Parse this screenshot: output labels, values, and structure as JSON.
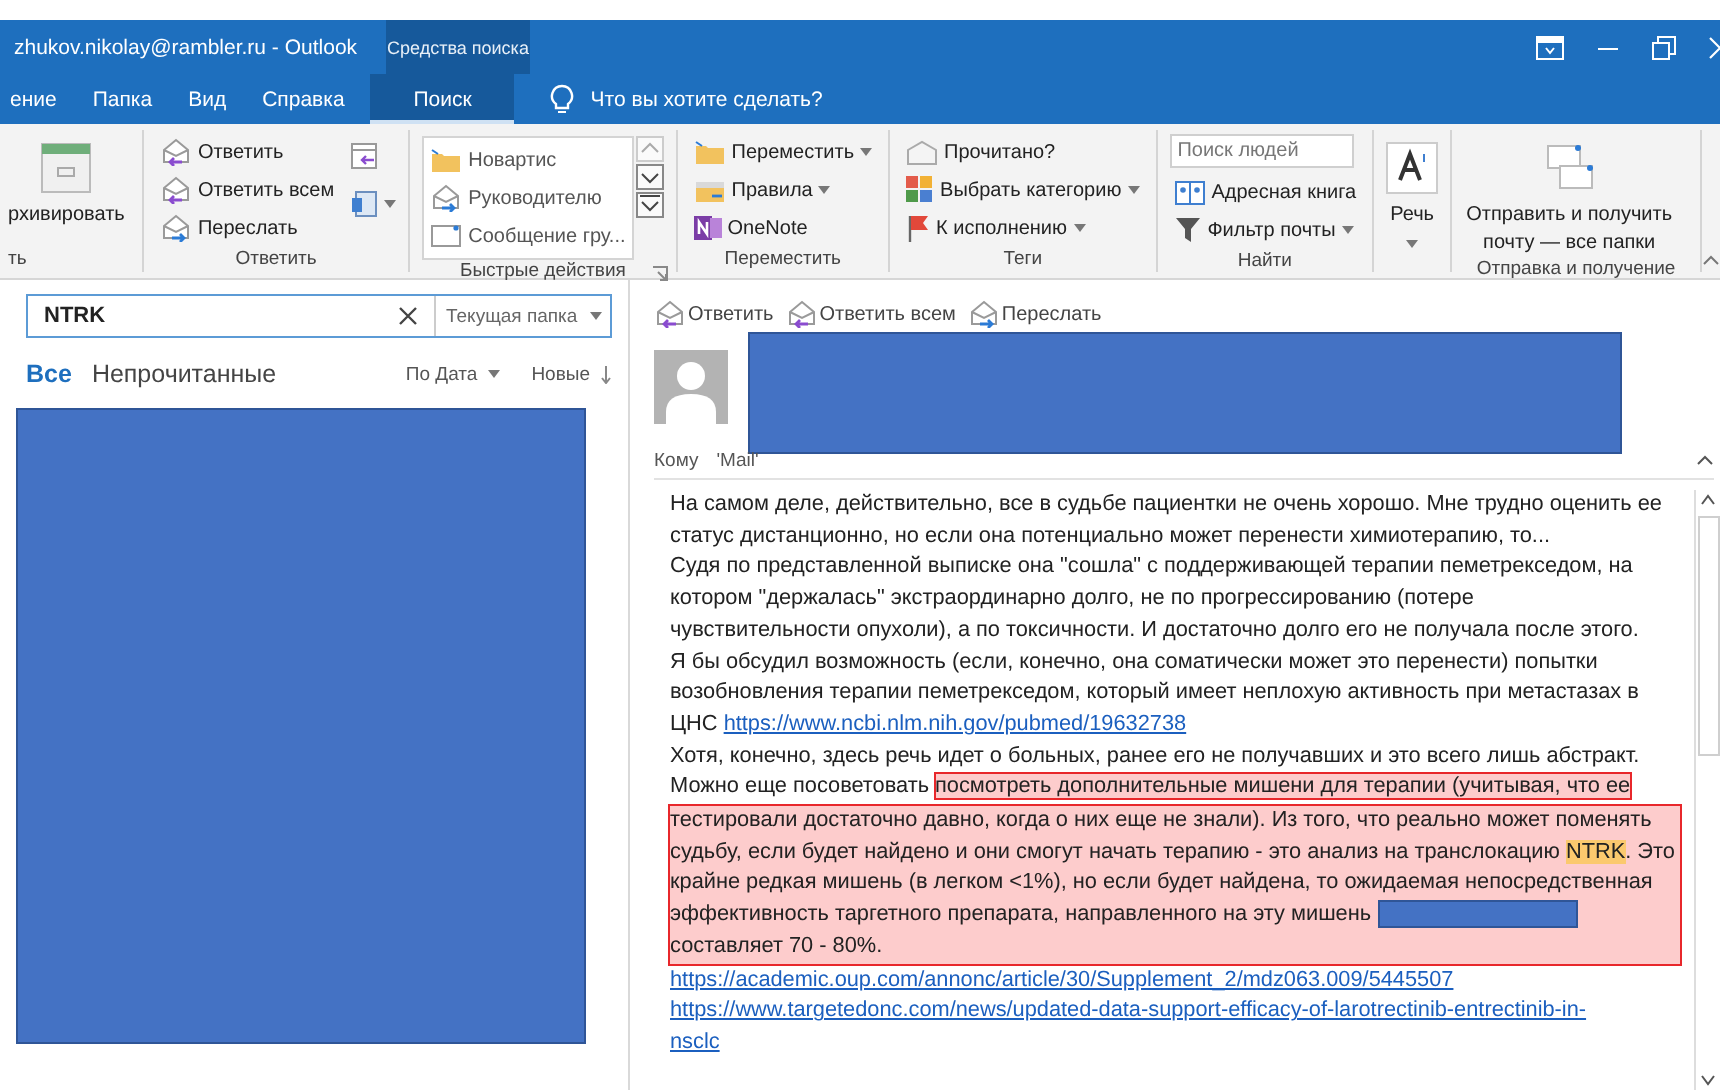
{
  "window": {
    "title": "zhukov.nikolay@rambler.ru  -  Outlook",
    "context_group": "Средства поиска"
  },
  "tabs": [
    {
      "label": "ение",
      "selected": false
    },
    {
      "label": "Папка",
      "selected": false
    },
    {
      "label": "Вид",
      "selected": false
    },
    {
      "label": "Справка",
      "selected": false
    },
    {
      "label": "Поиск",
      "selected": true,
      "contextual": true
    }
  ],
  "tell_me": {
    "placeholder": "Что вы хотите сделать?"
  },
  "ribbon": {
    "groups": [
      {
        "label": "ть",
        "items": [
          {
            "kind": "big",
            "label": "рхивировать"
          }
        ]
      },
      {
        "label": "Ответить",
        "items": [
          {
            "kind": "small",
            "label": "Ответить"
          },
          {
            "kind": "small",
            "label": "Ответить всем"
          },
          {
            "kind": "small",
            "label": "Переслать"
          },
          {
            "kind": "icon"
          },
          {
            "kind": "icon",
            "dropdown": true
          }
        ]
      },
      {
        "label": "Быстрые действия",
        "launcher": true,
        "items": [
          {
            "kind": "gallery",
            "entries": [
              "Новартис",
              "Руководителю",
              "Сообщение гру..."
            ]
          }
        ]
      },
      {
        "label": "Переместить",
        "items": [
          {
            "kind": "small",
            "label": "Переместить",
            "dropdown": true
          },
          {
            "kind": "small",
            "label": "Правила",
            "dropdown": true
          },
          {
            "kind": "small",
            "label": "OneNote"
          }
        ]
      },
      {
        "label": "Теги",
        "items": [
          {
            "kind": "small",
            "label": "Прочитано?"
          },
          {
            "kind": "small",
            "label": "Выбрать категорию",
            "dropdown": true
          },
          {
            "kind": "small",
            "label": "К исполнению",
            "dropdown": true
          }
        ]
      },
      {
        "label": "Найти",
        "items": [
          {
            "kind": "field",
            "placeholder": "Поиск людей"
          },
          {
            "kind": "small",
            "label": "Адресная книга"
          },
          {
            "kind": "small",
            "label": "Фильтр почты",
            "dropdown": true
          }
        ]
      },
      {
        "items": [
          {
            "kind": "big",
            "label": "Речь",
            "dropdown": true
          }
        ]
      },
      {
        "label": "Отправка и получение",
        "items": [
          {
            "kind": "big",
            "label": "Отправить и получить почту — все папки"
          }
        ]
      }
    ]
  },
  "search": {
    "value": "NTRK",
    "scope": "Текущая папка"
  },
  "filters": [
    {
      "label": "Все",
      "selected": true
    },
    {
      "label": "Непрочитанные",
      "selected": false
    }
  ],
  "sort": {
    "by": "По Дата",
    "order": "Новые"
  },
  "message": {
    "actions": [
      "Ответить",
      "Ответить всем",
      "Переслать"
    ],
    "to_label": "Кому",
    "to": "'Mail'",
    "body": [
      {
        "segments": [
          {
            "kind": "text",
            "text": "На самом деле, действительно, все в судьбе пациентки не очень хорошо. Мне трудно оценить ее",
            "marked": false
          }
        ]
      },
      {
        "segments": [
          {
            "kind": "text",
            "text": "статус дистанционно, но если она потенциально может перенести химиотерапию, то...",
            "marked": false
          }
        ]
      },
      {
        "segments": [
          {
            "kind": "text",
            "text": "Судя по представленной выписке она \"сошла\" с поддерживающей терапии пеметрекседом, на",
            "marked": false
          }
        ]
      },
      {
        "segments": [
          {
            "kind": "text",
            "text": "котором \"держалась\" экстраординарно долго, не по прогрессированию (потере",
            "marked": false
          }
        ]
      },
      {
        "segments": [
          {
            "kind": "text",
            "text": "чувствительности опухоли), а по токсичности. И достаточно долго его не получала после этого.",
            "marked": false
          }
        ]
      },
      {
        "segments": [
          {
            "kind": "text",
            "text": "Я бы обсудил возможность (если, конечно, она соматически может это перенести) попытки",
            "marked": false
          }
        ]
      },
      {
        "segments": [
          {
            "kind": "text",
            "text": "возобновления терапии пеметрекседом, который имеет неплохую активность при метастазах в",
            "marked": false
          }
        ]
      },
      {
        "segments": [
          {
            "kind": "text",
            "text": "ЦНС ",
            "marked": false
          },
          {
            "kind": "link",
            "text": "https://www.ncbi.nlm.nih.gov/pubmed/19632738",
            "marked": false
          }
        ]
      },
      {
        "segments": [
          {
            "kind": "text",
            "text": "Хотя, конечно, здесь речь идет о больных, ранее его не получавших и это всего лишь абстракт.",
            "marked": false
          }
        ]
      },
      {
        "segments": [
          {
            "kind": "text",
            "text": "Можно еще  посоветовать ",
            "marked": false
          },
          {
            "kind": "text",
            "text": "посмотреть дополнительные мишени для терапии (учитывая, что ее",
            "marked": true
          }
        ]
      },
      {
        "segments": [
          {
            "kind": "text",
            "text": "тестировали достаточно давно, когда о них еще не знали). Из того, что реально может поменять",
            "marked": true
          }
        ]
      },
      {
        "segments": [
          {
            "kind": "text",
            "text": "судьбу, если будет найдено и они смогут начать терапию - это анализ на транслокацию ",
            "marked": true
          },
          {
            "kind": "search_hit",
            "text": "NTRK",
            "marked": true
          },
          {
            "kind": "text",
            "text": ". Это",
            "marked": true
          }
        ]
      },
      {
        "segments": [
          {
            "kind": "text",
            "text": "крайне редкая мишень (в легком <1%), но если будет найдена, то ожидаемая непосредственная",
            "marked": true
          }
        ]
      },
      {
        "segments": [
          {
            "kind": "text",
            "text": "эффективность таргетного препарата, направленного на эту мишень ",
            "marked": true
          },
          {
            "kind": "redacted",
            "marked": true
          }
        ]
      },
      {
        "segments": [
          {
            "kind": "text",
            "text": "составляет 70 - 80%.",
            "marked": true
          }
        ]
      },
      {
        "segments": [
          {
            "kind": "link",
            "text": "https://academic.oup.com/annonc/article/30/Supplement_2/mdz063.009/5445507",
            "marked": false
          }
        ]
      },
      {
        "segments": [
          {
            "kind": "link",
            "text": "https://www.targetedonc.com/news/updated-data-support-efficacy-of-larotrectinib-entrectinib-in-",
            "marked": false
          }
        ]
      },
      {
        "segments": [
          {
            "kind": "link",
            "text": "nsclc",
            "marked": false
          }
        ]
      }
    ]
  }
}
